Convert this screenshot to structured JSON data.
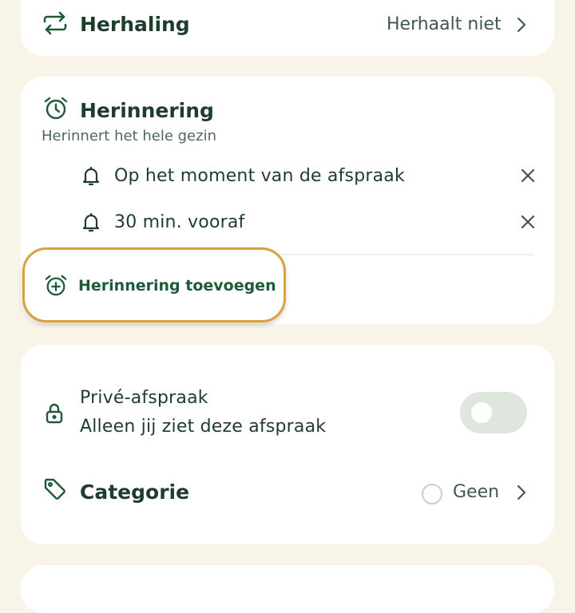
{
  "repeat": {
    "title": "Herhaling",
    "value": "Herhaalt niet"
  },
  "reminder": {
    "title": "Herinnering",
    "subtitle": "Herinnert het hele gezin",
    "items": [
      {
        "label": "Op het moment van de afspraak"
      },
      {
        "label": "30 min. vooraf"
      }
    ],
    "add_label": "Herinnering toevoegen"
  },
  "private": {
    "title": "Privé-afspraak",
    "subtitle": "Alleen jij ziet deze afspraak",
    "enabled": false
  },
  "category": {
    "title": "Categorie",
    "value": "Geen"
  },
  "colors": {
    "background": "#f8f4e8",
    "card": "#ffffff",
    "primary_green": "#1e5a3a",
    "highlight": "#d9a23f",
    "toggle_off": "#dfe6de"
  },
  "icons": {
    "repeat": "repeat-arrows-icon",
    "reminder": "alarm-clock-icon",
    "bell": "bell-icon",
    "remove": "close-icon",
    "add_reminder": "alarm-clock-plus-icon",
    "lock": "lock-icon",
    "category": "tag-icon",
    "chevron": "chevron-right-icon"
  }
}
